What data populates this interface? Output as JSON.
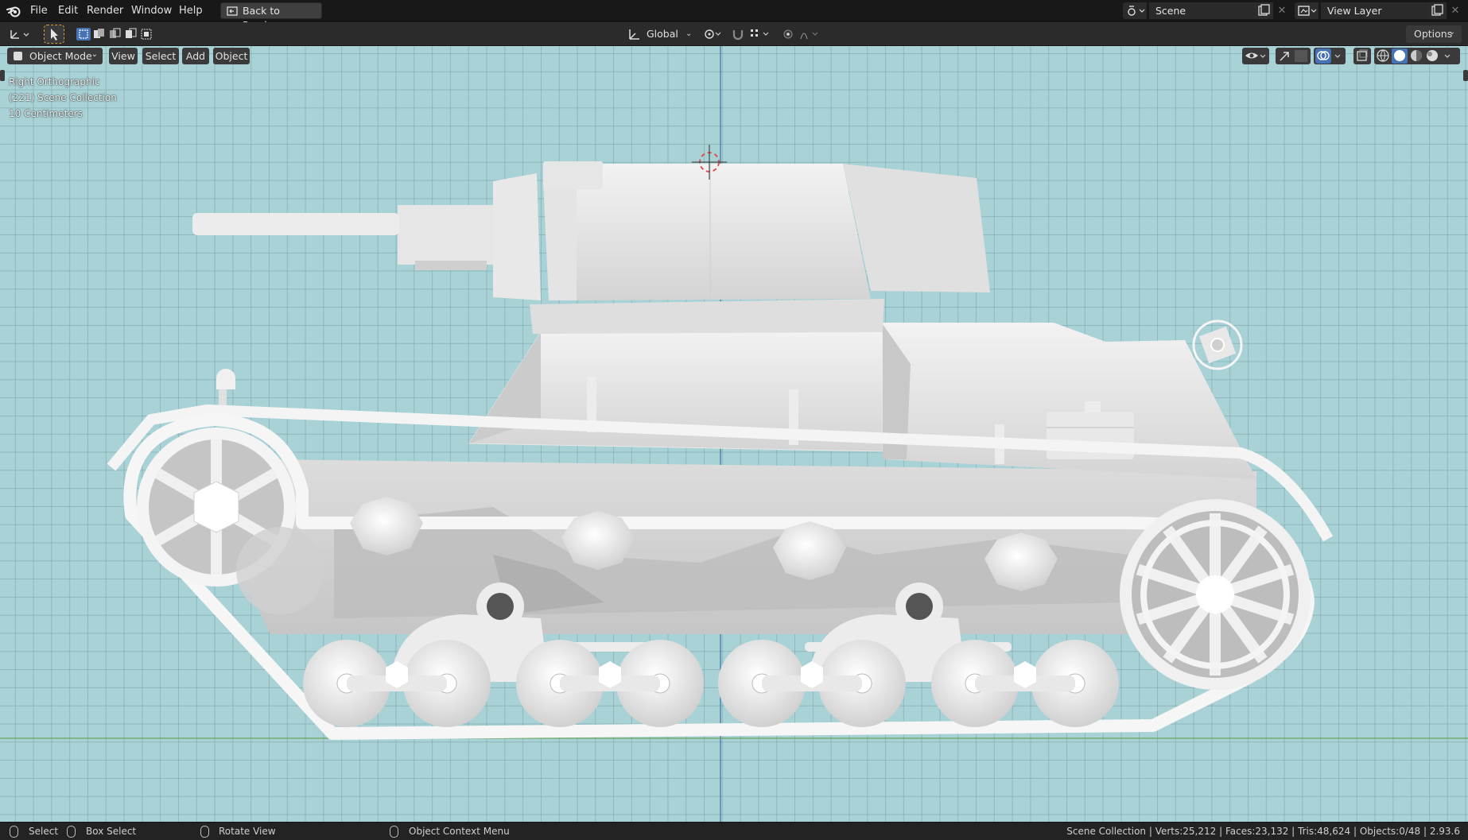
{
  "menu": {
    "items": [
      "File",
      "Edit",
      "Render",
      "Window",
      "Help"
    ],
    "back_label": "Back to Previous"
  },
  "scene": {
    "label": "Scene"
  },
  "view_layer": {
    "label": "View Layer"
  },
  "header": {
    "orientation": "Global",
    "options_label": "Options"
  },
  "viewport_header": {
    "mode": "Object Mode",
    "view": "View",
    "select": "Select",
    "add": "Add",
    "object": "Object"
  },
  "viewport_info": {
    "view_name": "Right Orthographic",
    "collection": "(221) Scene Collection",
    "scale": "10 Centimeters"
  },
  "status": {
    "select": "Select",
    "box_select": "Box Select",
    "rotate": "Rotate View",
    "context_menu": "Object Context Menu",
    "stats": "Scene Collection | Verts:25,212 | Faces:23,132 | Tris:48,624 | Objects:0/48 | 2.93.6"
  },
  "colors": {
    "viewport_bg": "#a9d2d6",
    "grid_line": "#7aa2a6",
    "accent_active": "#4772b3",
    "axis_blue": "#3a6ea5",
    "axis_green": "#6aa55a"
  }
}
